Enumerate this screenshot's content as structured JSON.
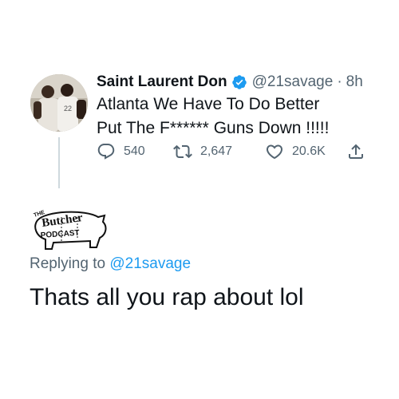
{
  "tweet": {
    "display_name": "Saint Laurent Don",
    "handle": "@21savage",
    "separator": "·",
    "time": "8h",
    "text": "Atlanta We Have To Do Better\nPut The F****** Guns Down !!!!!",
    "avatar_jersey_number": "22",
    "actions": {
      "reply_count": "540",
      "retweet_count": "2,647",
      "like_count": "20.6K"
    },
    "verified_color": "#1d9bf0"
  },
  "reply": {
    "logo_text": {
      "the": "THE",
      "brand": "Butcher",
      "podcast": "PODCAST"
    },
    "replying_prefix": "Replying to",
    "replying_handle": "@21savage",
    "text": "Thats all you rap about lol"
  },
  "colors": {
    "text": "#0f1419",
    "secondary": "#536471",
    "accent": "#1d9bf0",
    "thread_line": "#cfd9de"
  },
  "icons": [
    "verified-badge-icon",
    "reply-icon",
    "retweet-icon",
    "like-icon",
    "share-icon"
  ]
}
